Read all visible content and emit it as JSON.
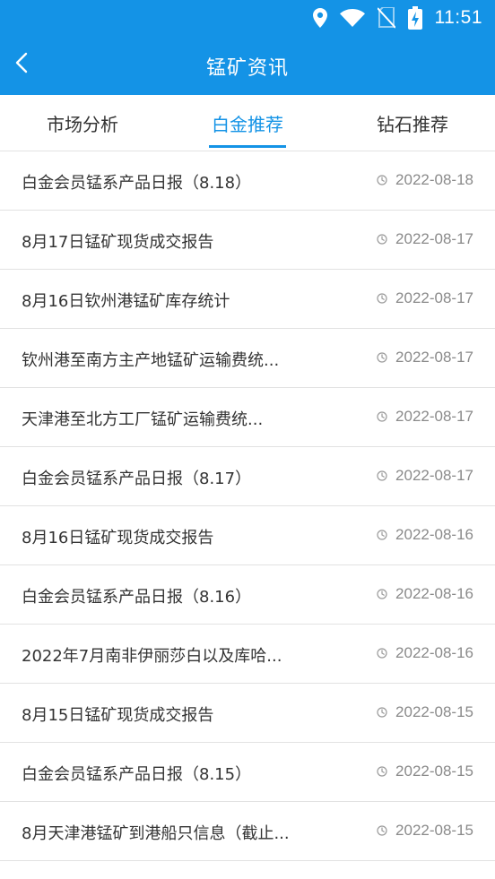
{
  "status_bar": {
    "time": "11:51",
    "icons": [
      "location-icon",
      "wifi-icon",
      "no-sim-icon",
      "battery-charging-icon"
    ]
  },
  "header": {
    "title": "锰矿资讯",
    "back_icon": "chevron-left-icon"
  },
  "colors": {
    "accent": "#1493e6",
    "text_primary": "#333333",
    "text_secondary": "#8a8a8a",
    "divider": "#e2e2e2"
  },
  "tabs": [
    {
      "label": "市场分析",
      "active": false
    },
    {
      "label": "白金推荐",
      "active": true
    },
    {
      "label": "钻石推荐",
      "active": false
    }
  ],
  "news": [
    {
      "title": "白金会员锰系产品日报（8.18）",
      "date": "2022-08-18"
    },
    {
      "title": "8月17日锰矿现货成交报告",
      "date": "2022-08-17"
    },
    {
      "title": "8月16日钦州港锰矿库存统计",
      "date": "2022-08-17"
    },
    {
      "title": "钦州港至南方主产地锰矿运输费统...",
      "date": "2022-08-17"
    },
    {
      "title": "天津港至北方工厂锰矿运输费统...",
      "date": "2022-08-17"
    },
    {
      "title": "白金会员锰系产品日报（8.17）",
      "date": "2022-08-17"
    },
    {
      "title": "8月16日锰矿现货成交报告",
      "date": "2022-08-16"
    },
    {
      "title": "白金会员锰系产品日报（8.16）",
      "date": "2022-08-16"
    },
    {
      "title": "2022年7月南非伊丽莎白以及库哈...",
      "date": "2022-08-16"
    },
    {
      "title": "8月15日锰矿现货成交报告",
      "date": "2022-08-15"
    },
    {
      "title": "白金会员锰系产品日报（8.15）",
      "date": "2022-08-15"
    },
    {
      "title": "8月天津港锰矿到港船只信息（截止...",
      "date": "2022-08-15"
    }
  ]
}
